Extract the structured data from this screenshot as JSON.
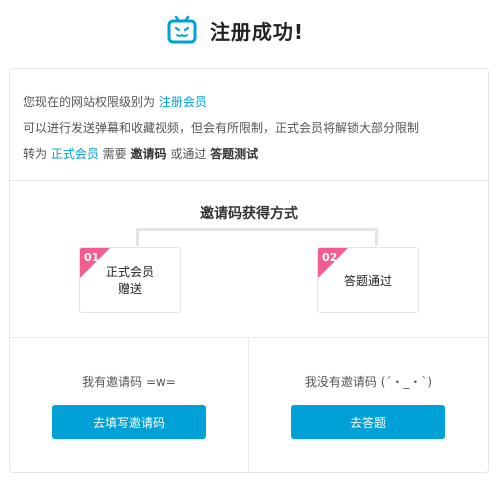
{
  "header": {
    "title": "注册成功!",
    "icon": "tv-icon"
  },
  "info": {
    "line1_prefix": "您现在的网站权限级别为 ",
    "line1_link": "注册会员",
    "line2": "可以进行发送弹幕和收藏视频，但会有所限制，正式会员将解锁大部分限制",
    "line3_prefix": "转为 ",
    "line3_link": "正式会员",
    "line3_mid1": " 需要 ",
    "line3_strong1": "邀请码",
    "line3_mid2": " 或通过 ",
    "line3_strong2": "答题测试"
  },
  "methods": {
    "title": "邀请码获得方式",
    "items": [
      {
        "num": "01",
        "label_line1": "正式会员",
        "label_line2": "赠送"
      },
      {
        "num": "02",
        "label_line1": "答题通过",
        "label_line2": ""
      }
    ]
  },
  "actions": {
    "left_text": "我有邀请码 =w=",
    "left_button": "去填写邀请码",
    "right_text": "我没有邀请码 (´・_・`)",
    "right_button": "去答题"
  },
  "colors": {
    "accent": "#00a1d6",
    "badge": "#f25d8e"
  }
}
